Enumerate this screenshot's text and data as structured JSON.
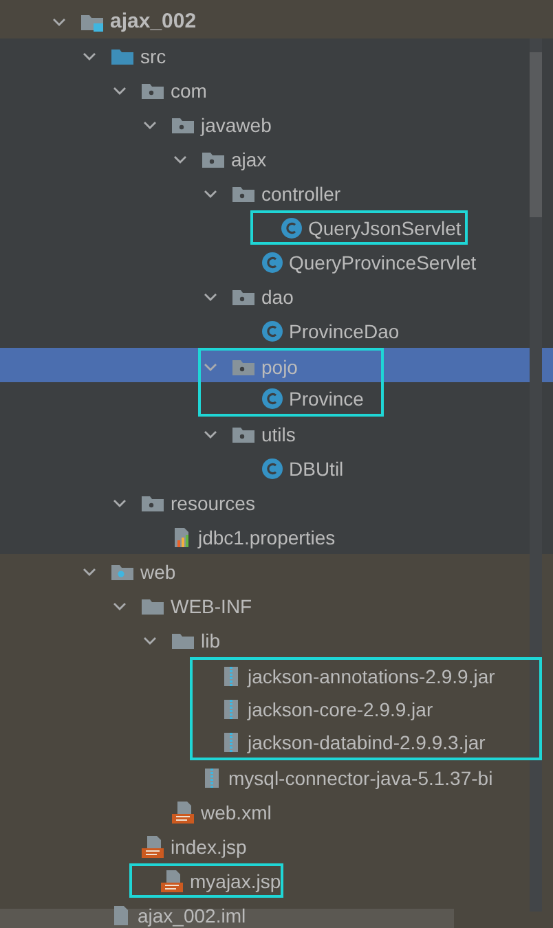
{
  "tree": [
    {
      "label": "ajax_002",
      "kind": "module",
      "expanded": true,
      "selected": false,
      "highlighted": false,
      "tinted": true,
      "children": [
        {
          "label": "src",
          "kind": "source-folder",
          "expanded": true,
          "selected": false,
          "highlighted": false,
          "tinted": false,
          "children": [
            {
              "label": "com",
              "kind": "package",
              "expanded": true,
              "selected": false,
              "highlighted": false,
              "tinted": false,
              "children": [
                {
                  "label": "javaweb",
                  "kind": "package",
                  "expanded": true,
                  "selected": false,
                  "highlighted": false,
                  "tinted": false,
                  "children": [
                    {
                      "label": "ajax",
                      "kind": "package",
                      "expanded": true,
                      "selected": false,
                      "highlighted": false,
                      "tinted": false,
                      "children": [
                        {
                          "label": "controller",
                          "kind": "package",
                          "expanded": true,
                          "selected": false,
                          "highlighted": false,
                          "tinted": false,
                          "children": [
                            {
                              "label": "QueryJsonServlet",
                              "kind": "class",
                              "selected": false,
                              "highlighted": true,
                              "tinted": false
                            },
                            {
                              "label": "QueryProvinceServlet",
                              "kind": "class",
                              "selected": false,
                              "highlighted": false,
                              "tinted": false
                            }
                          ]
                        },
                        {
                          "label": "dao",
                          "kind": "package",
                          "expanded": true,
                          "selected": false,
                          "highlighted": false,
                          "tinted": false,
                          "children": [
                            {
                              "label": "ProvinceDao",
                              "kind": "class",
                              "selected": false,
                              "highlighted": false,
                              "tinted": false
                            }
                          ]
                        },
                        {
                          "label": "pojo",
                          "kind": "package",
                          "expanded": true,
                          "selected": true,
                          "highlighted": true,
                          "tinted": false,
                          "children": [
                            {
                              "label": "Province",
                              "kind": "class",
                              "selected": false,
                              "highlighted": true,
                              "tinted": false
                            }
                          ]
                        },
                        {
                          "label": "utils",
                          "kind": "package",
                          "expanded": true,
                          "selected": false,
                          "highlighted": false,
                          "tinted": false,
                          "children": [
                            {
                              "label": "DBUtil",
                              "kind": "class",
                              "selected": false,
                              "highlighted": false,
                              "tinted": false
                            }
                          ]
                        }
                      ]
                    }
                  ]
                }
              ]
            },
            {
              "label": "resources",
              "kind": "package",
              "expanded": true,
              "selected": false,
              "highlighted": false,
              "tinted": false,
              "children": [
                {
                  "label": "jdbc1.properties",
                  "kind": "properties",
                  "selected": false,
                  "highlighted": false,
                  "tinted": false
                }
              ]
            }
          ]
        },
        {
          "label": "web",
          "kind": "web-folder",
          "expanded": true,
          "selected": false,
          "highlighted": false,
          "tinted": true,
          "children": [
            {
              "label": "WEB-INF",
              "kind": "folder",
              "expanded": true,
              "selected": false,
              "highlighted": false,
              "tinted": true,
              "children": [
                {
                  "label": "lib",
                  "kind": "folder",
                  "expanded": true,
                  "selected": false,
                  "highlighted": false,
                  "tinted": true,
                  "children": [
                    {
                      "label": "jackson-annotations-2.9.9.jar",
                      "kind": "jar",
                      "selected": false,
                      "highlighted": true,
                      "tinted": true
                    },
                    {
                      "label": "jackson-core-2.9.9.jar",
                      "kind": "jar",
                      "selected": false,
                      "highlighted": true,
                      "tinted": true
                    },
                    {
                      "label": "jackson-databind-2.9.9.3.jar",
                      "kind": "jar",
                      "selected": false,
                      "highlighted": true,
                      "tinted": true
                    },
                    {
                      "label": "mysql-connector-java-5.1.37-bi",
                      "kind": "jar",
                      "selected": false,
                      "highlighted": false,
                      "tinted": true
                    }
                  ]
                },
                {
                  "label": "web.xml",
                  "kind": "xml",
                  "selected": false,
                  "highlighted": false,
                  "tinted": true
                }
              ]
            },
            {
              "label": "index.jsp",
              "kind": "jsp",
              "selected": false,
              "highlighted": false,
              "tinted": true
            },
            {
              "label": "myajax.jsp",
              "kind": "jsp",
              "selected": false,
              "highlighted": true,
              "tinted": true
            }
          ]
        },
        {
          "label": "ajax_002.iml",
          "kind": "iml",
          "selected": false,
          "highlighted": false,
          "tinted": true
        }
      ]
    }
  ]
}
